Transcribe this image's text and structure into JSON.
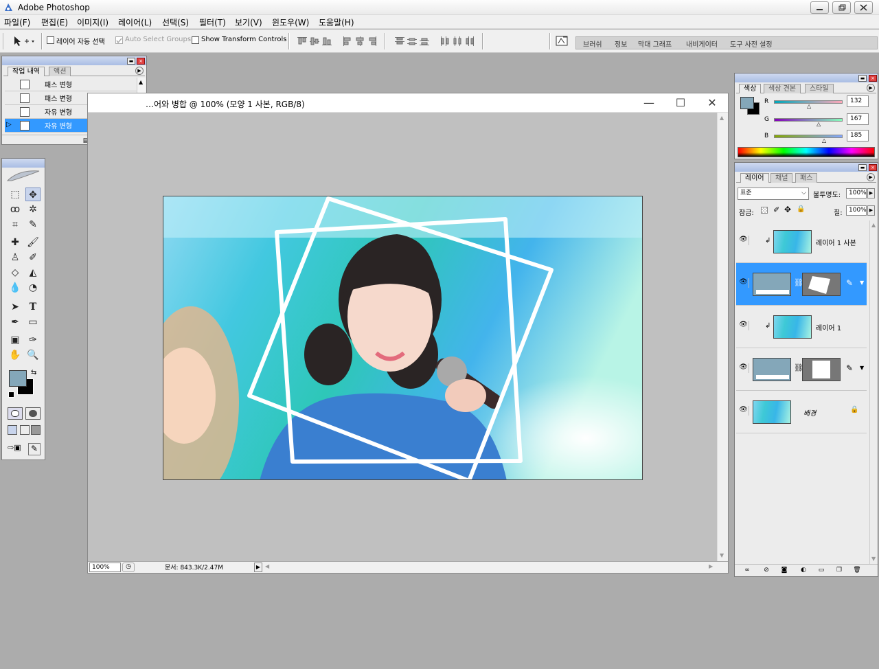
{
  "app": {
    "title": "Adobe Photoshop"
  },
  "menu": [
    "파일(F)",
    "편집(E)",
    "이미지(I)",
    "레이어(L)",
    "선택(S)",
    "필터(T)",
    "보기(V)",
    "윈도우(W)",
    "도움말(H)"
  ],
  "options": {
    "auto_select_layer": "레이어 자동 선택",
    "auto_select_groups": "Auto Select Groups",
    "show_transform": "Show Transform Controls"
  },
  "palette_well": [
    "브러쉬",
    "정보",
    "막대 그래프",
    "내비게이터",
    "도구 사전 설정"
  ],
  "history_panel": {
    "tabs": [
      "작업 내역",
      "액션"
    ],
    "items": [
      "패스 변형",
      "패스 변형",
      "자유 변형",
      "자유 변형"
    ],
    "selected_index": 3
  },
  "document": {
    "title": "…어와 병합 @ 100% (모양 1 사본, RGB/8)",
    "zoom": "100%",
    "doc_size": "문서: 843.3K/2.47M"
  },
  "color_panel": {
    "tabs": [
      "색상",
      "색상 견본",
      "스타일"
    ],
    "channels": [
      {
        "label": "R",
        "value": "132"
      },
      {
        "label": "G",
        "value": "167"
      },
      {
        "label": "B",
        "value": "185"
      }
    ],
    "foreground": "#84a7b9",
    "background": "#000000"
  },
  "layers_panel": {
    "tabs": [
      "레이어",
      "채널",
      "패스"
    ],
    "blend_mode": "표준",
    "opacity_label": "불투명도:",
    "opacity": "100%",
    "lock_label": "잠금:",
    "fill_label": "칠:",
    "fill": "100%",
    "layers": [
      {
        "name": "레이어 1 사본",
        "type": "clipped"
      },
      {
        "name": "",
        "type": "shape-selected"
      },
      {
        "name": "레이어 1",
        "type": "clipped"
      },
      {
        "name": "",
        "type": "shape"
      },
      {
        "name": "배경",
        "type": "background"
      }
    ]
  },
  "colors": {
    "selection": "#3399ff",
    "titlebar_start": "#cfdaf0",
    "titlebar_end": "#a9bde4"
  }
}
